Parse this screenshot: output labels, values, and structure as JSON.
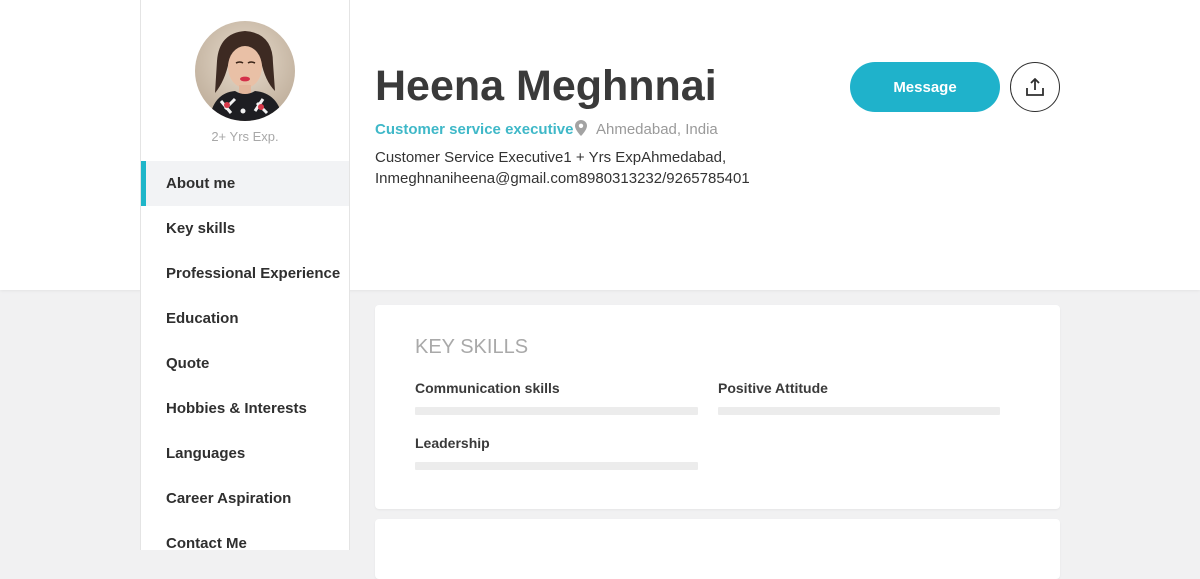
{
  "profile": {
    "experience": "2+ Yrs Exp.",
    "name": "Heena Meghnnai",
    "role": "Customer service executive",
    "location": "Ahmedabad, India",
    "bio_line1": "Customer Service Executive1 + Yrs ExpAhmedabad,",
    "bio_line2": "Inmeghnaniheena@gmail.com8980313232/9265785401"
  },
  "sidebar": {
    "items": [
      {
        "label": "About me",
        "active": true
      },
      {
        "label": "Key skills"
      },
      {
        "label": "Professional Experience"
      },
      {
        "label": "Education"
      },
      {
        "label": "Quote"
      },
      {
        "label": "Hobbies & Interests"
      },
      {
        "label": "Languages"
      },
      {
        "label": "Career Aspiration"
      },
      {
        "label": "Contact Me"
      }
    ]
  },
  "actions": {
    "message_label": "Message",
    "share_icon": "share-upload-icon"
  },
  "key_skills": {
    "title": "KEY SKILLS",
    "skills": [
      {
        "name": "Communication skills"
      },
      {
        "name": "Positive Attitude"
      },
      {
        "name": "Leadership"
      }
    ]
  },
  "colors": {
    "accent": "#1fb2cb",
    "role_text": "#3fb8c8",
    "page_bg": "#f1f1f2"
  }
}
